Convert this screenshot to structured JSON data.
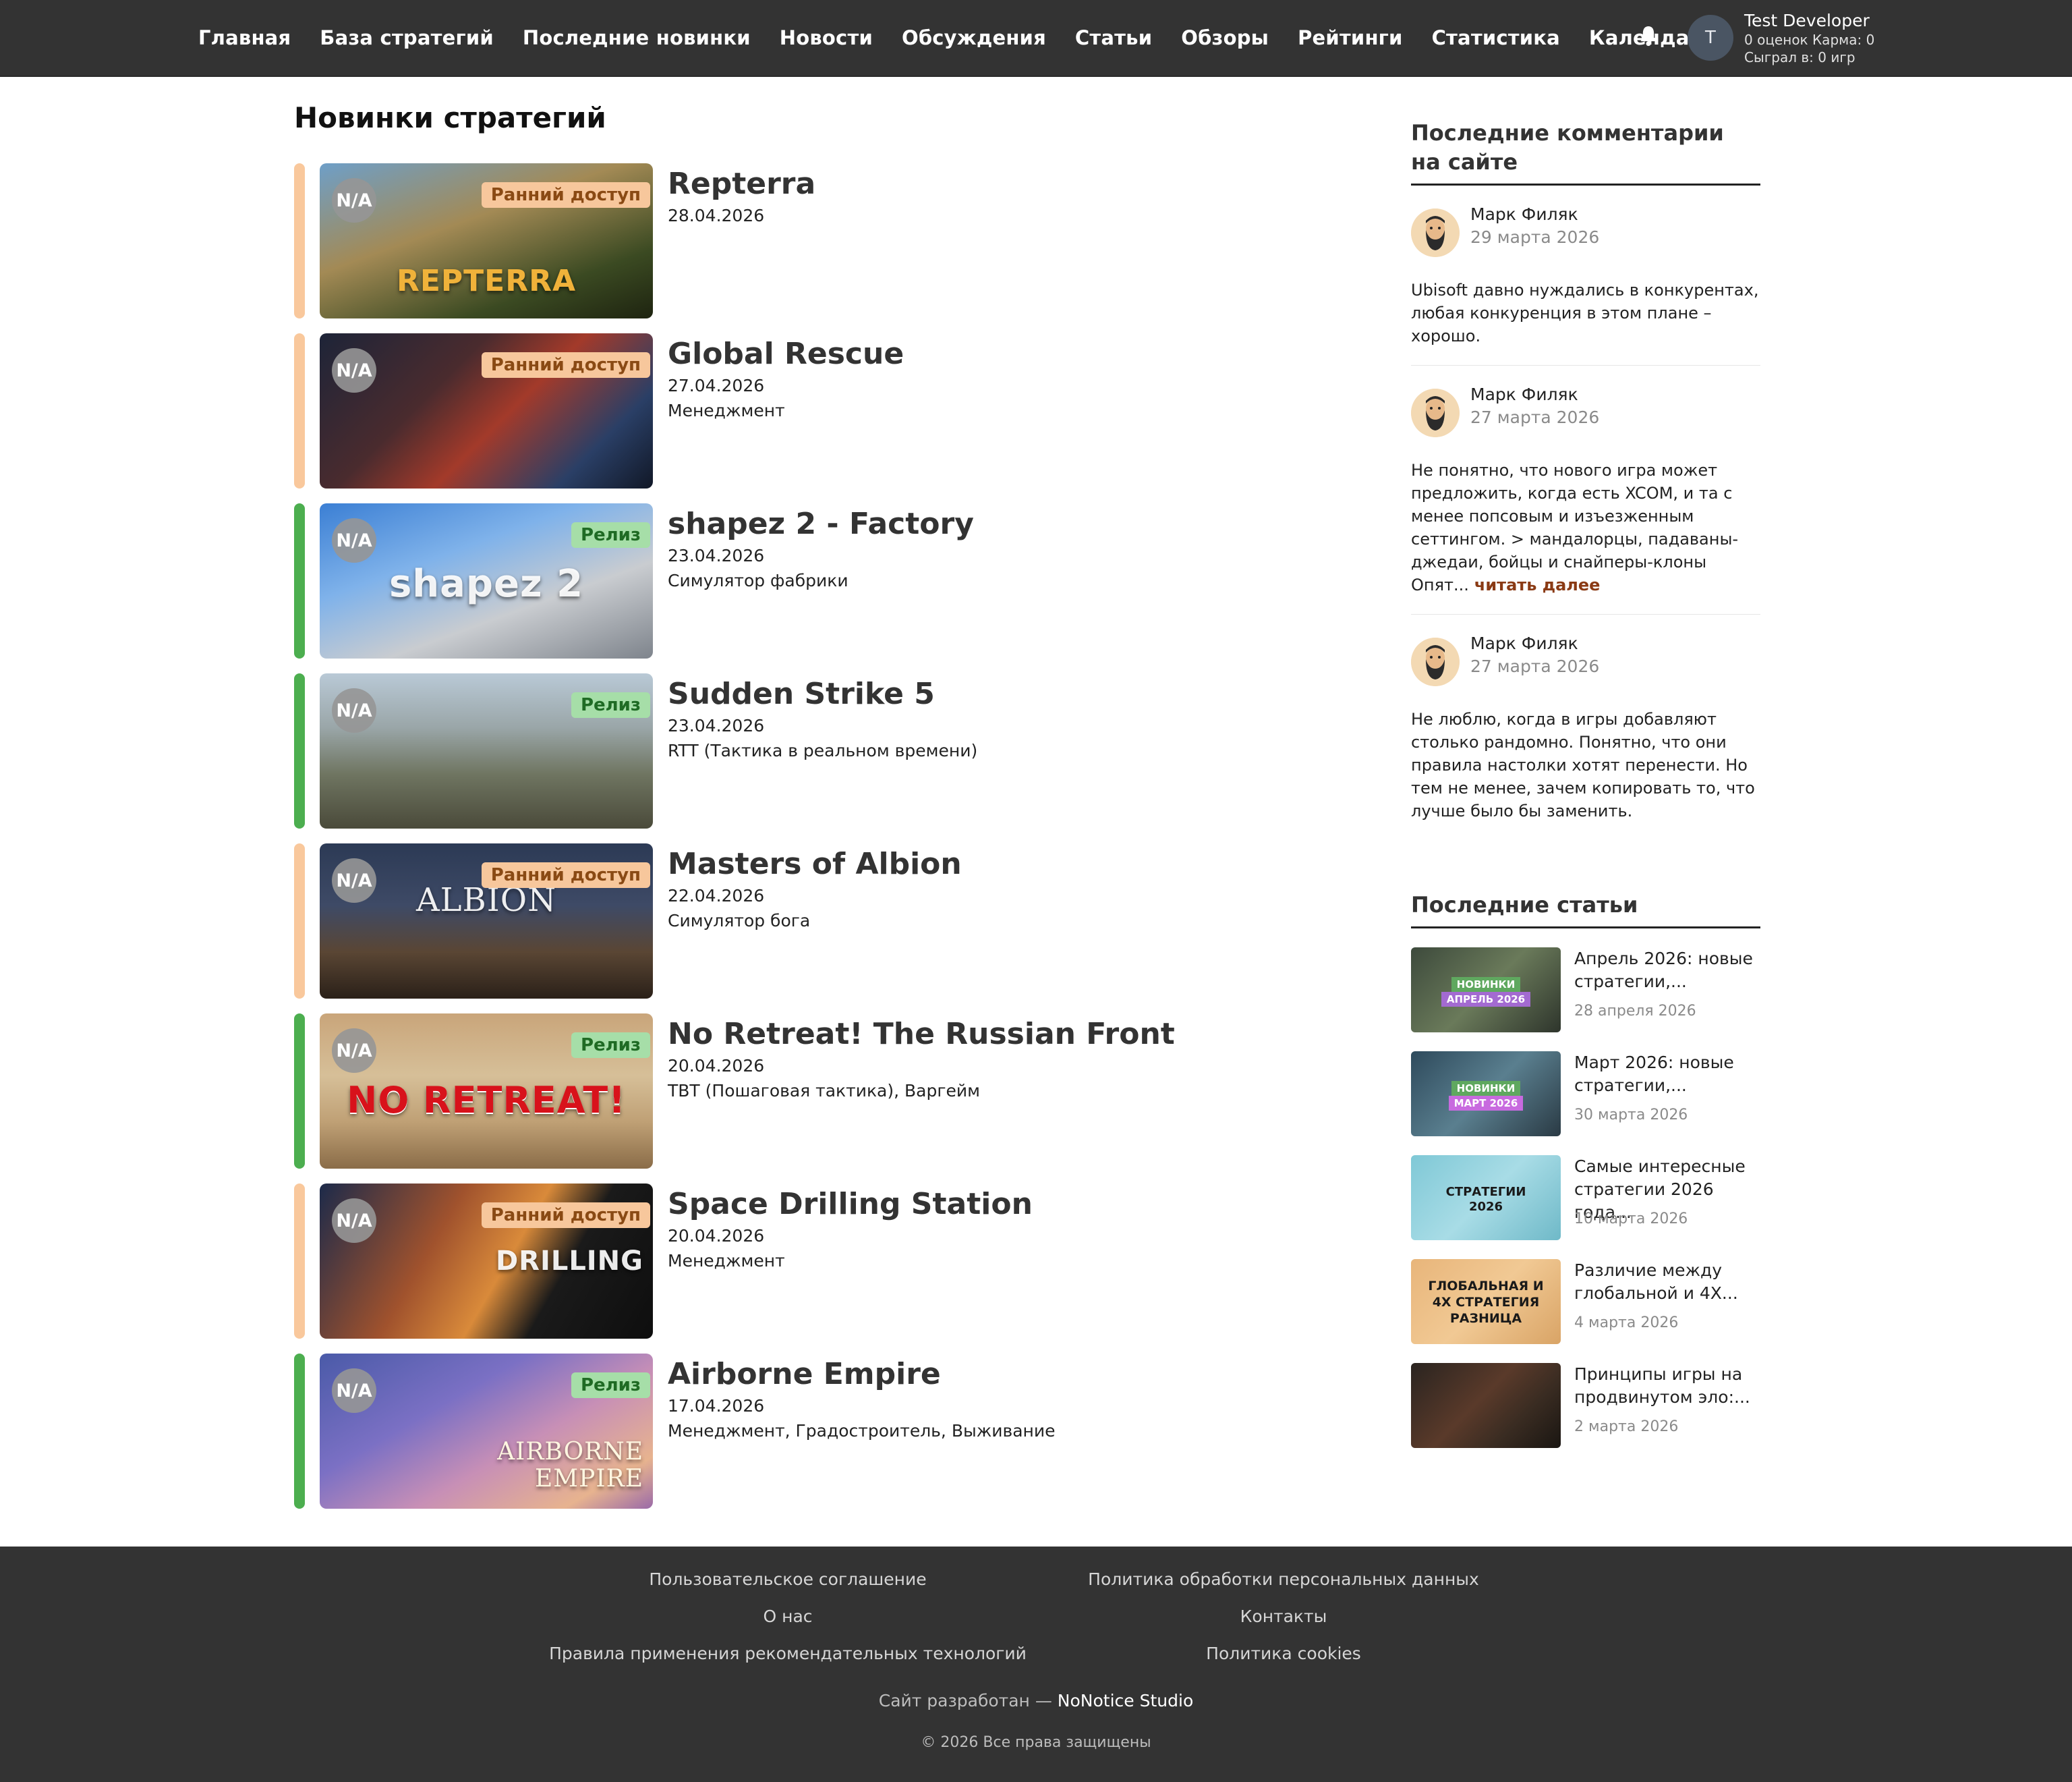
{
  "nav": {
    "items": [
      "Главная",
      "База стратегий",
      "Последние новинки",
      "Новости",
      "Обсуждения",
      "Статьи",
      "Обзоры",
      "Рейтинги",
      "Статистика",
      "Календарь"
    ]
  },
  "user": {
    "initial": "T",
    "name": "Test Developer",
    "ratings_karma": "0 оценок Карма: 0",
    "played": "Сыграл в: 0 игр",
    "bell_icon": "bell-icon"
  },
  "page": {
    "title": "Новинки стратегий"
  },
  "games": [
    {
      "title": "Repterra",
      "date": "28.04.2026",
      "genre": "",
      "rating": "N/A",
      "stage": "Ранний доступ",
      "thumb_text": "REPTERRA"
    },
    {
      "title": "Global Rescue",
      "date": "27.04.2026",
      "genre": "Менеджмент",
      "rating": "N/A",
      "stage": "Ранний доступ",
      "thumb_text": ""
    },
    {
      "title": "shapez 2 - Factory",
      "date": "23.04.2026",
      "genre": "Симулятор фабрики",
      "rating": "N/A",
      "stage": "Релиз",
      "thumb_text": "shapez 2"
    },
    {
      "title": "Sudden Strike 5",
      "date": "23.04.2026",
      "genre": "RTT (Тактика в реальном времени)",
      "rating": "N/A",
      "stage": "Релиз",
      "thumb_text": ""
    },
    {
      "title": "Masters of Albion",
      "date": "22.04.2026",
      "genre": "Симулятор бога",
      "rating": "N/A",
      "stage": "Ранний доступ",
      "thumb_text": "ALBION"
    },
    {
      "title": "No Retreat! The Russian Front",
      "date": "20.04.2026",
      "genre": "TBT (Пошаговая тактика), Варгейм",
      "rating": "N/A",
      "stage": "Релиз",
      "thumb_text": "NO RETREAT!"
    },
    {
      "title": "Space Drilling Station",
      "date": "20.04.2026",
      "genre": "Менеджмент",
      "rating": "N/A",
      "stage": "Ранний доступ",
      "thumb_text": "DRILLING"
    },
    {
      "title": "Airborne Empire",
      "date": "17.04.2026",
      "genre": "Менеджмент, Градостроитель, Выживание",
      "rating": "N/A",
      "stage": "Релиз",
      "thumb_text": "AIRBORNE EMPIRE"
    }
  ],
  "comments": {
    "title": "Последние комментарии на сайте",
    "items": [
      {
        "author": "Марк Филяк",
        "date": "29 марта 2026",
        "text": "Ubisoft давно нуждались в конкурентах, любая конкуренция в этом плане – хорошо.",
        "more": ""
      },
      {
        "author": "Марк Филяк",
        "date": "27 марта 2026",
        "text": "Не понятно, что нового игра может предложить, когда есть XCOM, и та с менее попсовым и изъезженным сеттингом. > мандалорцы, падаваны-джедаи, бойцы и снайперы-клоны Опят...",
        "more": "читать далее"
      },
      {
        "author": "Марк Филяк",
        "date": "27 марта 2026",
        "text": "Не люблю, когда в игры добавляют столько рандомно. Понятно, что они правила настолки хотят перенести. Но тем не менее, зачем копировать то, что лучше было бы заменить.",
        "more": ""
      }
    ]
  },
  "articles": {
    "title": "Последние статьи",
    "items": [
      {
        "title": "Апрель 2026: новые стратегии,...",
        "date": "28 апреля 2026",
        "thumb_line1": "НОВИНКИ",
        "thumb_line2": "АПРЕЛЬ 2026"
      },
      {
        "title": "Март 2026: новые стратегии,...",
        "date": "30 марта 2026",
        "thumb_line1": "НОВИНКИ",
        "thumb_line2": "МАРТ 2026"
      },
      {
        "title": "Самые интересные стратегии 2026 года...",
        "date": "10 марта 2026",
        "thumb_line1": "СТРАТЕГИИ",
        "thumb_line2": "2026"
      },
      {
        "title": "Различие между глобальной и 4X...",
        "date": "4 марта 2026",
        "thumb_line1": "ГЛОБАЛЬНАЯ И 4X СТРАТЕГИЯ",
        "thumb_line2": "РАЗНИЦА"
      },
      {
        "title": "Принципы игры на продвинутом эло:...",
        "date": "2 марта 2026",
        "thumb_line1": "",
        "thumb_line2": ""
      }
    ]
  },
  "footer": {
    "links": [
      "Пользовательское соглашение",
      "Политика обработки персональных данных",
      "О нас",
      "Контакты",
      "Правила применения рекомендательных технологий",
      "Политика cookies"
    ],
    "developed_prefix": "Сайт разработан —",
    "developer": "NoNotice Studio",
    "copyright": "© 2026 Все права защищены"
  },
  "colors": {
    "topbar": "#333333",
    "early_access_bar": "#f9c89c",
    "release_bar": "#4cae4f",
    "early_badge": "#f7c79c",
    "release_badge": "#a6dea8",
    "read_more": "#8a3a14"
  }
}
